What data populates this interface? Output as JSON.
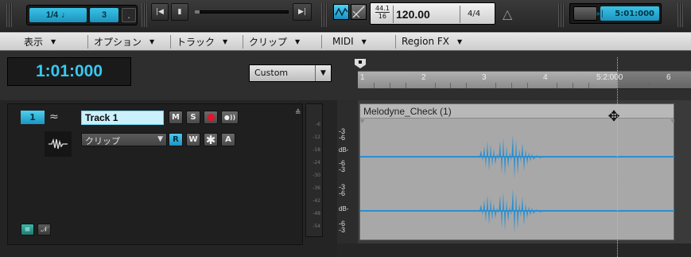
{
  "transport": {
    "snap_value": "1/4",
    "snap_note": "♩",
    "snap_count": "3",
    "snap_dot": ".",
    "rate_top": "44.1",
    "rate_bottom": "16",
    "tempo": "120.00",
    "time_signature": "4/4",
    "loop_time": "5:01:000"
  },
  "menu": {
    "items": [
      "表示",
      "オプション",
      "トラック",
      "クリップ",
      "MIDI",
      "Region FX"
    ]
  },
  "time_display": {
    "now_time": "1:01:000",
    "format": "Custom"
  },
  "ruler": {
    "marks": [
      "1",
      "2",
      "3",
      "4",
      "5:2:000",
      "6"
    ]
  },
  "track": {
    "number": "1",
    "name": "Track 1",
    "buttons": {
      "mute": "M",
      "solo": "S",
      "read": "R",
      "write": "W",
      "archive": "A"
    },
    "clip_mode": "クリップ",
    "meter_scale": [
      "-6",
      "-12",
      "-18",
      "-24",
      "-30",
      "-36",
      "-42",
      "-48",
      "-54"
    ]
  },
  "clip": {
    "title": "Melodyne_Check (1)",
    "db_labels_top": [
      "-3",
      "-6",
      "dB-",
      "-6",
      "-3"
    ],
    "db_labels_bottom": [
      "-3",
      "-6",
      "dB-",
      "-6",
      "-3"
    ]
  },
  "colors": {
    "accent": "#2aa8d8",
    "waveform": "#2a8fd0",
    "record": "#e8122a"
  }
}
